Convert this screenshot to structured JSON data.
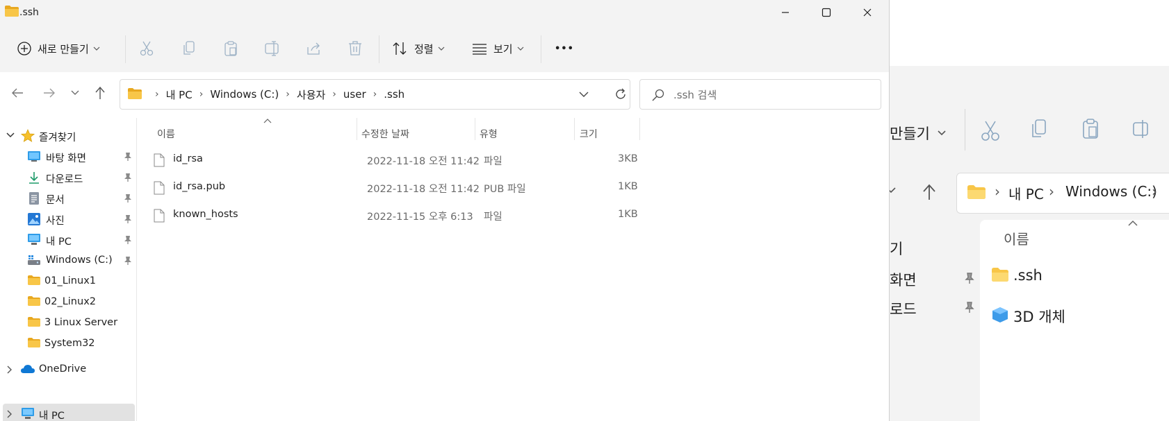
{
  "window": {
    "title": ".ssh",
    "minimize_icon": "minimize-icon",
    "maximize_icon": "maximize-icon",
    "close_icon": "close-icon"
  },
  "toolbar": {
    "new_label": "새로 만들기",
    "sort_label": "정렬",
    "view_label": "보기",
    "more_label": "•••",
    "icons": [
      "cut-icon",
      "copy-icon",
      "paste-icon",
      "rename-icon",
      "share-icon",
      "delete-icon"
    ]
  },
  "address": {
    "crumbs": [
      "내 PC",
      "Windows (C:)",
      "사용자",
      "user",
      ".ssh"
    ]
  },
  "search": {
    "placeholder": ".ssh 검색"
  },
  "sidebar": {
    "favorites": "즐겨찾기",
    "items": [
      {
        "label": "바탕 화면",
        "icon": "desktop-icon",
        "pinned": true
      },
      {
        "label": "다운로드",
        "icon": "download-icon",
        "pinned": true
      },
      {
        "label": "문서",
        "icon": "document-icon",
        "pinned": true
      },
      {
        "label": "사진",
        "icon": "pictures-icon",
        "pinned": true
      },
      {
        "label": "내 PC",
        "icon": "pc-icon",
        "pinned": true
      },
      {
        "label": "Windows (C:)",
        "icon": "drive-icon",
        "pinned": true
      },
      {
        "label": "01_Linux1",
        "icon": "folder-icon",
        "pinned": false
      },
      {
        "label": "02_Linux2",
        "icon": "folder-icon",
        "pinned": false
      },
      {
        "label": "3 Linux Server",
        "icon": "folder-icon",
        "pinned": false
      },
      {
        "label": "System32",
        "icon": "folder-icon",
        "pinned": false
      }
    ],
    "onedrive": "OneDrive",
    "thispc": "내 PC"
  },
  "filelist": {
    "columns": [
      "이름",
      "수정한 날짜",
      "유형",
      "크기"
    ],
    "rows": [
      {
        "name": "id_rsa",
        "date": "2022-11-18 오전 11:42",
        "type": "파일",
        "size": "3KB"
      },
      {
        "name": "id_rsa.pub",
        "date": "2022-11-18 오전 11:42",
        "type": "PUB 파일",
        "size": "1KB"
      },
      {
        "name": "known_hosts",
        "date": "2022-11-15 오후 6:13",
        "type": "파일",
        "size": "1KB"
      }
    ]
  },
  "bg_window": {
    "new_label_partial": "만들기",
    "crumbs": [
      "내 PC",
      "Windows (C:)"
    ],
    "sidebar_partial": [
      "기",
      "화면",
      "로드"
    ],
    "column_name": "이름",
    "items": [
      ".ssh",
      "3D 개체"
    ]
  },
  "colors": {
    "folder_yellow": "#f8c648",
    "accent_blue": "#0067c0",
    "chrome_grey": "#f3f3f3"
  }
}
